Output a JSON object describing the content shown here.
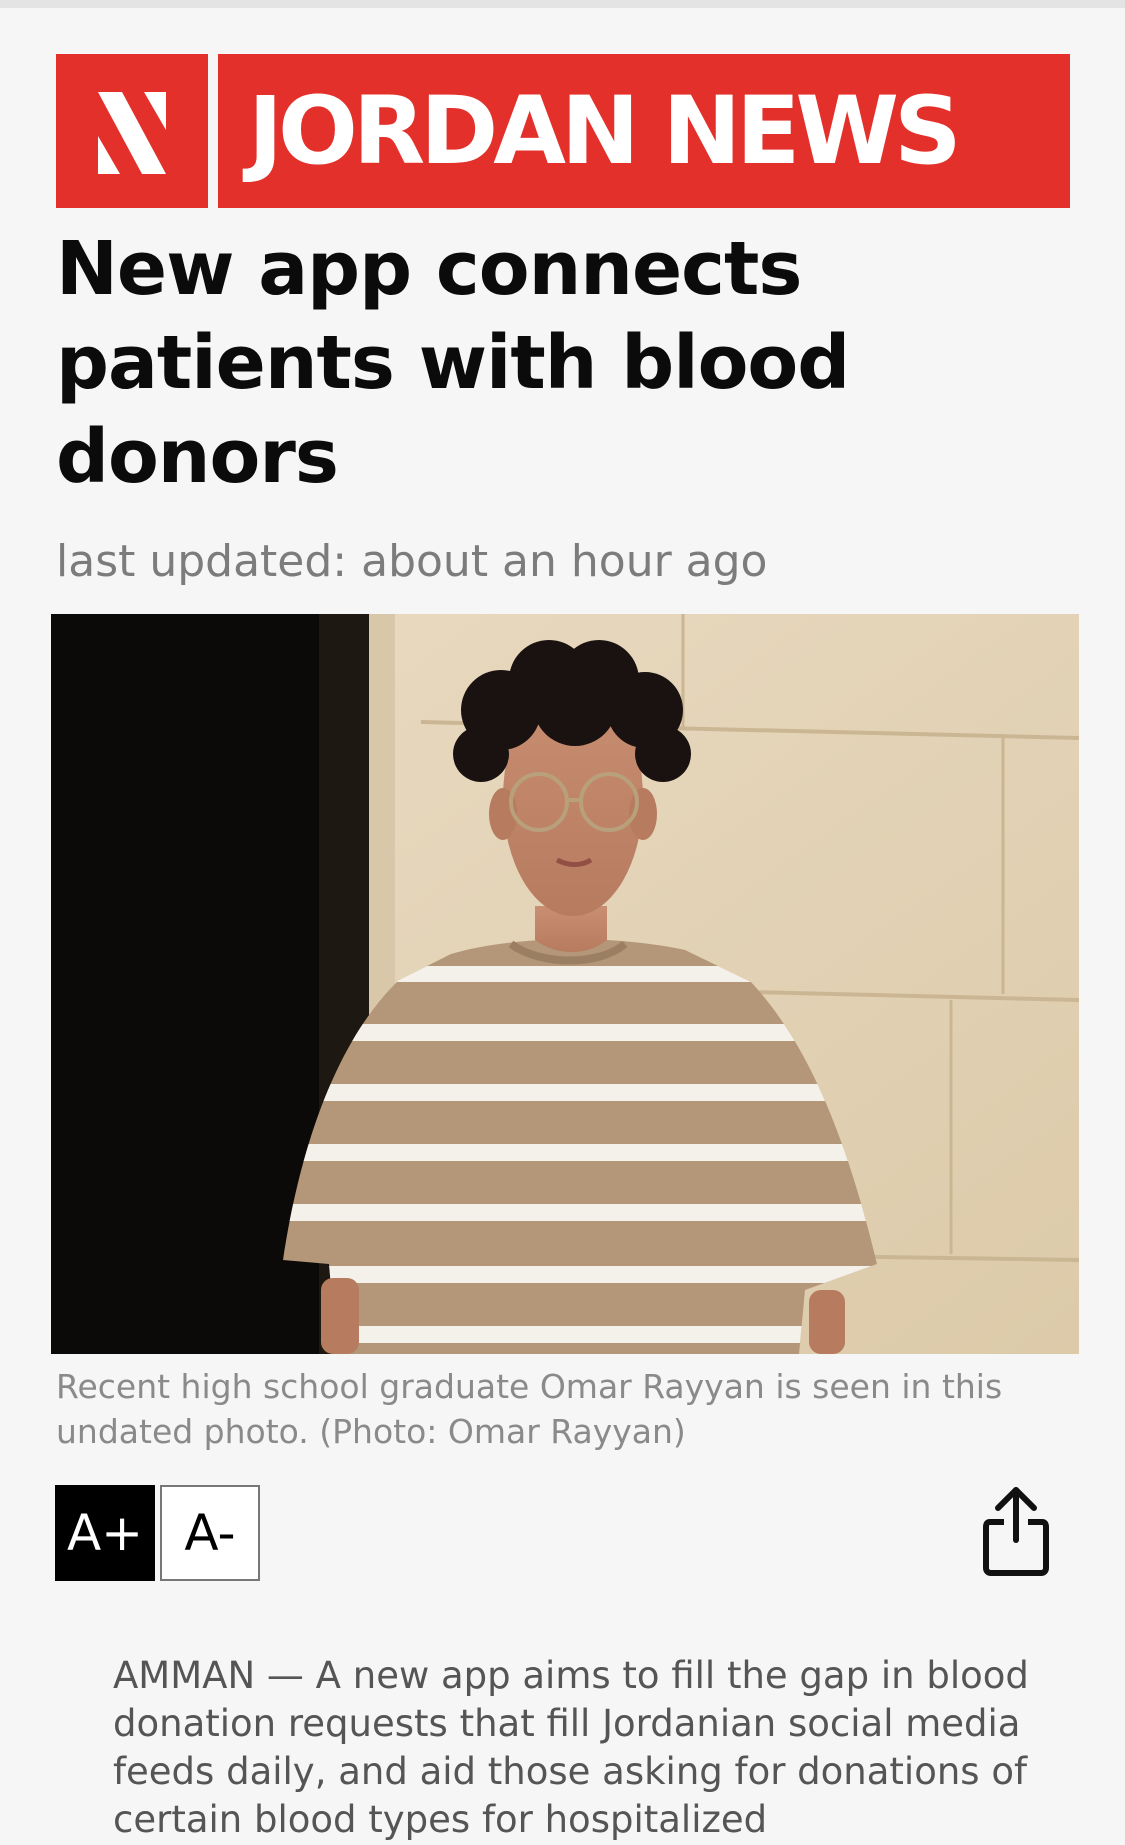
{
  "brand": {
    "name": "JORDAN NEWS",
    "color": "#e4302b"
  },
  "article": {
    "headline": "New app connects patients with blood donors",
    "updated": "last updated: about an hour ago",
    "caption": "Recent high school graduate Omar Rayyan is seen in this undated photo. (Photo: Omar Rayyan)",
    "body": "AMMAN — A new app aims to fill the gap in blood donation requests that fill Jordanian social media feeds daily, and aid those asking for donations of certain blood types for hospitalized"
  },
  "controls": {
    "font_increase": "A+",
    "font_decrease": "A-",
    "share_icon": "share-icon"
  }
}
